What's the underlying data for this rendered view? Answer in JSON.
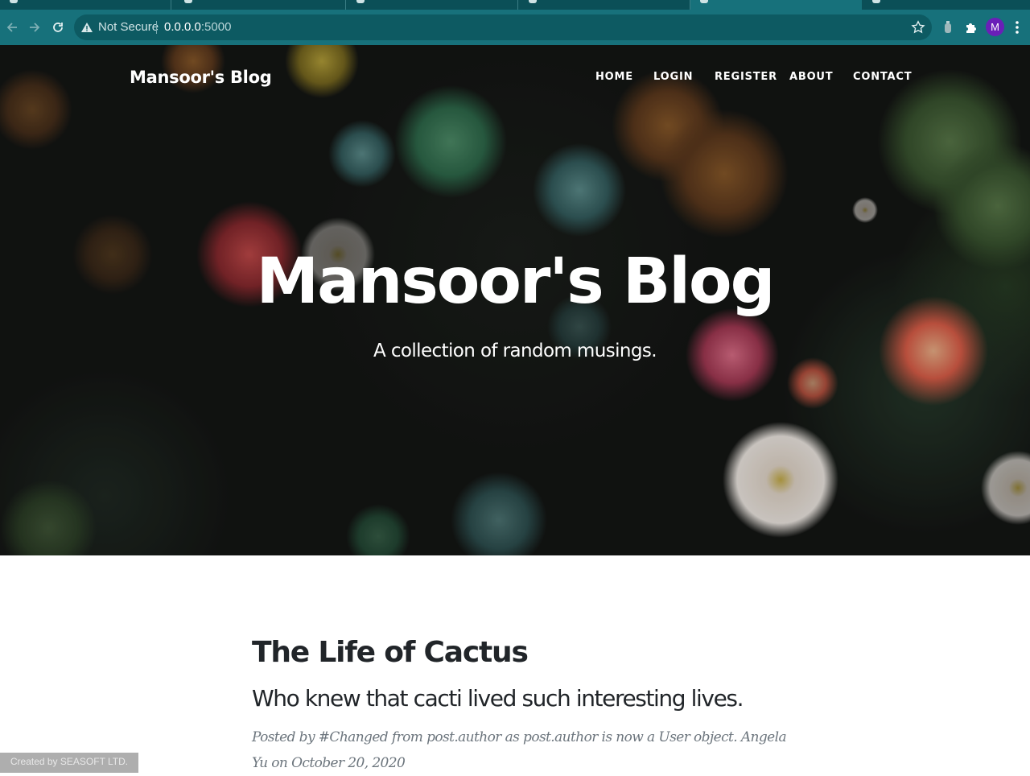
{
  "browser": {
    "security_label": "Not Secure",
    "url_host": "0.0.0.0",
    "url_port": ":5000",
    "profile_initial": "M"
  },
  "colors": {
    "chrome_toolbar": "#17717b",
    "chrome_tabstrip": "#0b4f57",
    "profile_avatar": "#6a1fb8",
    "text_dark": "#212529",
    "text_muted": "#6c757d"
  },
  "navbar": {
    "brand": "Mansoor's Blog",
    "links": [
      "HOME",
      "LOGIN",
      "REGISTER",
      "ABOUT",
      "CONTACT"
    ]
  },
  "hero": {
    "title": "Mansoor's Blog",
    "subtitle": "A collection of random musings."
  },
  "post": {
    "title": "The Life of Cactus",
    "subtitle": "Who knew that cacti lived such interesting lives.",
    "meta": "Posted by #Changed from post.author as post.author is now a User object. Angela Yu on October 20, 2020"
  },
  "watermark": "Created by SEASOFT LTD."
}
